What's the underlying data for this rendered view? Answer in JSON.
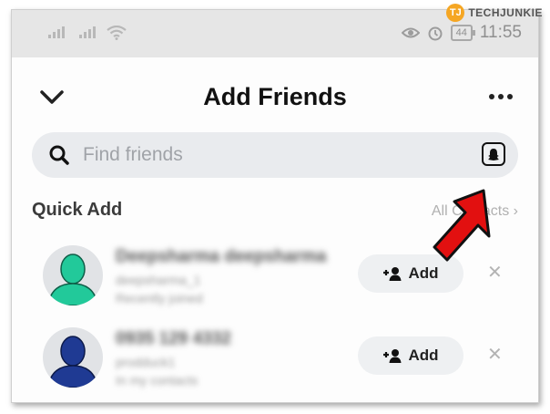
{
  "status_bar": {
    "time": "11:55",
    "battery": "44"
  },
  "watermark": {
    "initials": "TJ",
    "brand": "TECHJUNKIE"
  },
  "header": {
    "title": "Add Friends"
  },
  "search": {
    "placeholder": "Find friends"
  },
  "quick_add": {
    "heading": "Quick Add",
    "all_contacts_label": "All Contacts",
    "people": [
      {
        "name": "Deepsharma deepsharma",
        "username": "deepsharma_1",
        "reason": "Recently joined",
        "add_label": "Add",
        "avatar_color": "#22c99a"
      },
      {
        "name": "0935 129 4332",
        "username": "prodduck1",
        "reason": "In my contacts",
        "add_label": "Add",
        "avatar_color": "#1f3a93"
      }
    ]
  },
  "colors": {
    "annotation_arrow": "#e21010",
    "search_bg": "#e9ebee"
  }
}
